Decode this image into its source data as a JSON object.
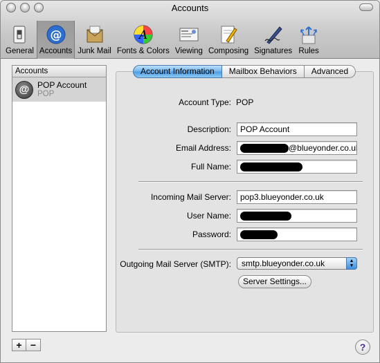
{
  "window": {
    "title": "Accounts"
  },
  "toolbar": {
    "items": [
      {
        "label": "General",
        "icon": "light-switch-icon"
      },
      {
        "label": "Accounts",
        "icon": "at-sign-icon",
        "selected": true
      },
      {
        "label": "Junk Mail",
        "icon": "junk-mail-icon"
      },
      {
        "label": "Fonts & Colors",
        "icon": "color-wheel-icon"
      },
      {
        "label": "Viewing",
        "icon": "mail-viewing-icon"
      },
      {
        "label": "Composing",
        "icon": "pencil-paper-icon"
      },
      {
        "label": "Signatures",
        "icon": "signature-pen-icon"
      },
      {
        "label": "Rules",
        "icon": "rules-arrows-icon"
      }
    ]
  },
  "accounts_list": {
    "header": "Accounts",
    "items": [
      {
        "name": "POP Account",
        "type": "POP",
        "avatar": "@"
      }
    ],
    "add_label": "+",
    "remove_label": "−"
  },
  "tabs": [
    {
      "label": "Account Information",
      "active": true
    },
    {
      "label": "Mailbox Behaviors",
      "active": false
    },
    {
      "label": "Advanced",
      "active": false
    }
  ],
  "form": {
    "account_type_label": "Account Type:",
    "account_type_value": "POP",
    "description_label": "Description:",
    "description_value": "POP Account",
    "email_label": "Email Address:",
    "email_suffix": "@blueyonder.co.uk",
    "fullname_label": "Full Name:",
    "incoming_label": "Incoming Mail Server:",
    "incoming_value": "pop3.blueyonder.co.uk",
    "username_label": "User Name:",
    "password_label": "Password:",
    "outgoing_label": "Outgoing Mail Server (SMTP):",
    "outgoing_value": "smtp.blueyonder.co.uk",
    "server_settings_label": "Server Settings..."
  },
  "help": {
    "label": "?"
  },
  "colors": {
    "tab_active": "#5aa8ec",
    "redaction": "#000000"
  }
}
